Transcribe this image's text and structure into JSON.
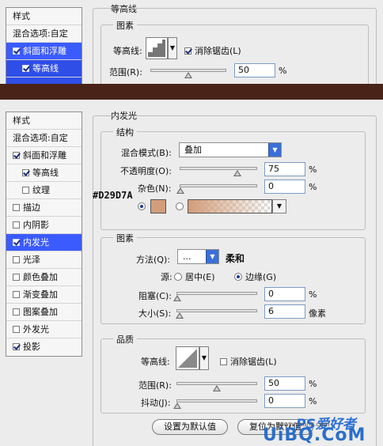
{
  "top_panel": {
    "styles_header": "样式",
    "blend_options": "混合选项:自定",
    "items": [
      {
        "label": "斜面和浮雕",
        "checked": true
      },
      {
        "label": "等高线",
        "checked": true
      }
    ],
    "section_title": "等高线",
    "group_title": "图素",
    "contour_label": "等高线:",
    "antialias_label": "消除锯齿(L)",
    "antialias_checked": true,
    "range_label": "范围(R):",
    "range_value": "50",
    "range_unit": "%",
    "range_fraction": 0.5
  },
  "bottom_panel": {
    "styles_header": "样式",
    "blend_options": "混合选项:自定",
    "items": [
      {
        "label": "斜面和浮雕",
        "checked": true,
        "indent": false
      },
      {
        "label": "等高线",
        "checked": true,
        "indent": true
      },
      {
        "label": "纹理",
        "checked": false,
        "indent": true
      },
      {
        "label": "描边",
        "checked": false,
        "indent": false
      },
      {
        "label": "内阴影",
        "checked": false,
        "indent": false
      },
      {
        "label": "内发光",
        "checked": true,
        "indent": false,
        "selected": true
      },
      {
        "label": "光泽",
        "checked": false,
        "indent": false
      },
      {
        "label": "颜色叠加",
        "checked": false,
        "indent": false
      },
      {
        "label": "渐变叠加",
        "checked": false,
        "indent": false
      },
      {
        "label": "图案叠加",
        "checked": false,
        "indent": false
      },
      {
        "label": "外发光",
        "checked": false,
        "indent": false
      },
      {
        "label": "投影",
        "checked": true,
        "indent": false
      }
    ],
    "section_title": "内发光",
    "structure": {
      "title": "结构",
      "blend_mode_label": "混合模式(B):",
      "blend_mode_value": "叠加",
      "opacity_label": "不透明度(O):",
      "opacity_value": "75",
      "opacity_unit": "%",
      "opacity_fraction": 0.75,
      "noise_label": "杂色(N):",
      "noise_value": "0",
      "noise_unit": "%",
      "noise_fraction": 0.0,
      "color_annotation": "#D29D7A",
      "glow_color": "#d29d7a"
    },
    "elements": {
      "title": "图素",
      "technique_label": "方法(Q):",
      "technique_value": "...",
      "technique_note": "柔和",
      "source_label": "源:",
      "source_center": "居中(E)",
      "source_edge": "边缘(G)",
      "source_selected": "edge",
      "choke_label": "阻塞(C):",
      "choke_value": "0",
      "choke_unit": "%",
      "choke_fraction": 0.0,
      "size_label": "大小(S):",
      "size_value": "6",
      "size_unit": "像素",
      "size_fraction": 0.03
    },
    "quality": {
      "title": "品质",
      "contour_label": "等高线:",
      "antialias_label": "消除锯齿(L)",
      "antialias_checked": false,
      "range_label": "范围(R):",
      "range_value": "50",
      "range_unit": "%",
      "range_fraction": 0.5,
      "jitter_label": "抖动(J):",
      "jitter_value": "0",
      "jitter_unit": "%",
      "jitter_fraction": 0.0
    },
    "buttons": {
      "make_default": "设置为默认值",
      "reset_default": "复位为默认值"
    }
  },
  "watermark": {
    "line1": "PS爱好者",
    "line2": "UiBQ.CoM",
    "site": "www.psahz.com"
  },
  "colors": {
    "accent": "#3b5bff",
    "divider": "#4a2318",
    "glow": "#d29d7a"
  }
}
